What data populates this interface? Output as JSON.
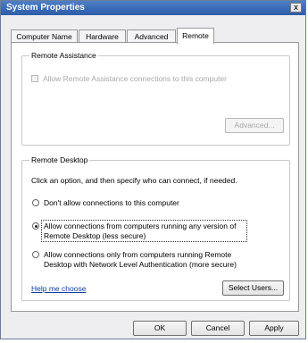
{
  "window": {
    "title": "System Properties",
    "close_glyph": "x"
  },
  "tabs": [
    {
      "label": "Computer Name",
      "active": false
    },
    {
      "label": "Hardware",
      "active": false
    },
    {
      "label": "Advanced",
      "active": false
    },
    {
      "label": "Remote",
      "active": true
    }
  ],
  "remote_assistance": {
    "group_title": "Remote Assistance",
    "checkbox_label": "Allow Remote Assistance connections to this computer",
    "checkbox_checked": false,
    "checkbox_enabled": false,
    "advanced_button": "Advanced..."
  },
  "remote_desktop": {
    "group_title": "Remote Desktop",
    "instruction": "Click an option, and then specify who can connect, if needed.",
    "options": [
      {
        "line1": "Don't allow connections to this computer",
        "line2": "",
        "selected": false
      },
      {
        "line1": "Allow connections from computers running any version of",
        "line2": "Remote Desktop (less secure)",
        "selected": true
      },
      {
        "line1": "Allow connections only from computers running Remote",
        "line2": "Desktop with Network Level Authentication (more secure)",
        "selected": false
      }
    ],
    "help_link": "Help me choose",
    "select_users_button": "Select Users..."
  },
  "footer": {
    "ok": "OK",
    "cancel": "Cancel",
    "apply": "Apply"
  },
  "colors": {
    "titlebar": "#3b6cb8",
    "link": "#0b3fa3",
    "window_bg": "#eeeef0"
  },
  "icons": {
    "close": "close-icon"
  }
}
